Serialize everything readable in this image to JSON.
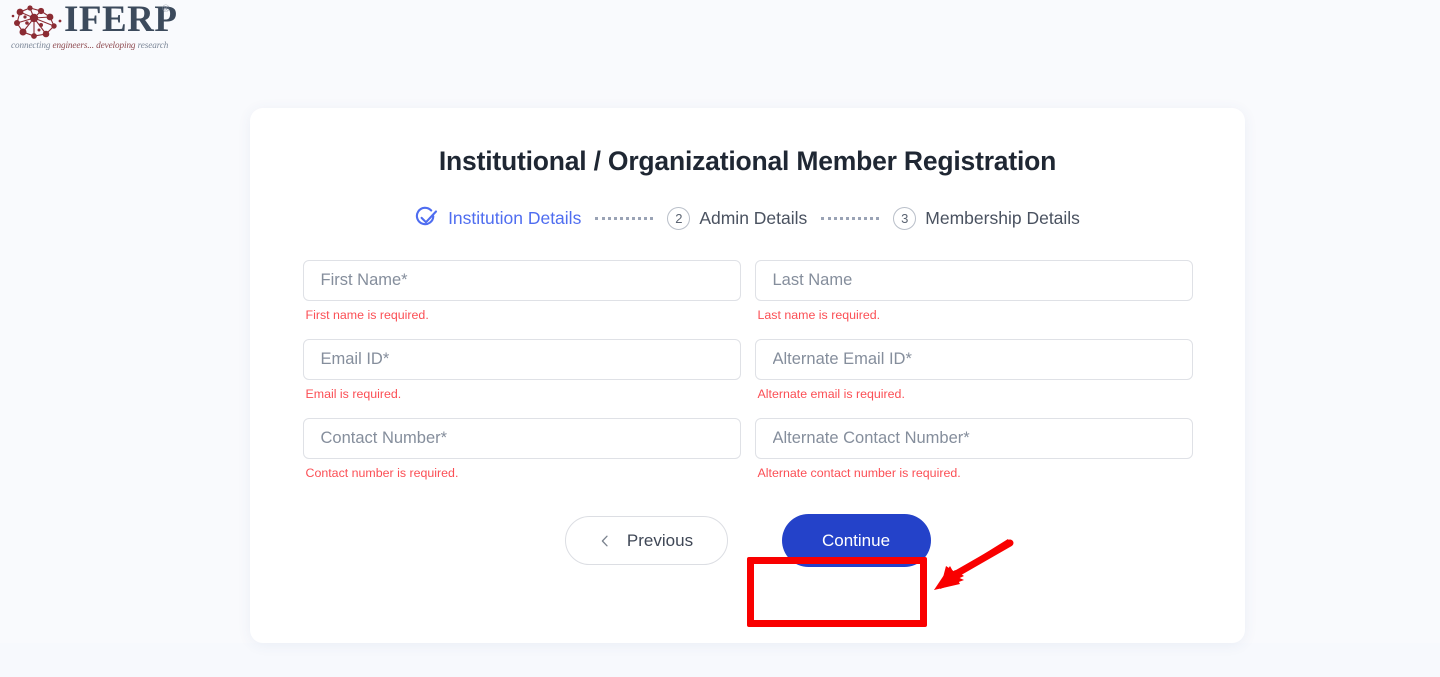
{
  "brand": {
    "name": "IFERP",
    "registered_mark": "®",
    "tagline_lead": "connecting ",
    "tagline_em": "engineers... developing ",
    "tagline_tail": "research",
    "logo_icon": "molecular-network-icon",
    "logo_color": "#8b2b33",
    "wordmark_color": "#3c4a5c"
  },
  "card": {
    "title": "Institutional / Organizational Member Registration"
  },
  "stepper": {
    "steps": [
      {
        "badge": "✓",
        "label": "Institution Details",
        "state": "completed",
        "icon": "check-circle-icon"
      },
      {
        "badge": "2",
        "label": "Admin Details",
        "state": "upcoming",
        "icon": "step-number-icon"
      },
      {
        "badge": "3",
        "label": "Membership Details",
        "state": "upcoming",
        "icon": "step-number-icon"
      }
    ],
    "active_color": "#4f6df0",
    "inactive_color": "#4a5260",
    "connector_style": "dotted"
  },
  "form": {
    "fields": [
      {
        "name": "first-name",
        "placeholder": "First Name*",
        "value": "",
        "error": "First name is required."
      },
      {
        "name": "last-name",
        "placeholder": "Last Name",
        "value": "",
        "error": "Last name is required."
      },
      {
        "name": "email-id",
        "placeholder": "Email ID*",
        "value": "",
        "error": "Email is required."
      },
      {
        "name": "alternate-email-id",
        "placeholder": "Alternate Email ID*",
        "value": "",
        "error": "Alternate email is required."
      },
      {
        "name": "contact-number",
        "placeholder": "Contact Number*",
        "value": "",
        "error": "Contact number is required."
      },
      {
        "name": "alternate-contact-number",
        "placeholder": "Alternate Contact Number*",
        "value": "",
        "error": "Alternate contact number is required."
      }
    ],
    "error_color": "#fb4f55"
  },
  "actions": {
    "previous_label": "Previous",
    "previous_icon": "chevron-left-icon",
    "continue_label": "Continue",
    "continue_color": "#2442c9"
  },
  "annotation": {
    "highlight_color": "#f90000",
    "highlight_target": "Continue",
    "arrow_icon": "arrow-pointing-down-left-icon"
  }
}
